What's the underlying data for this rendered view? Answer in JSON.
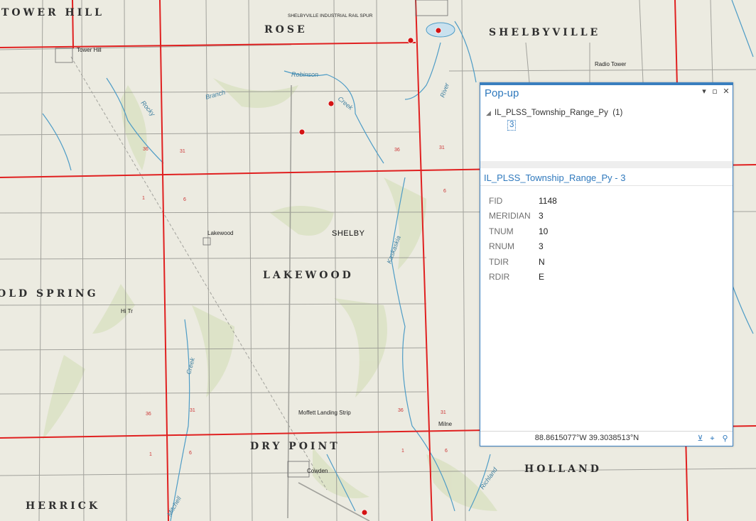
{
  "map": {
    "townships": [
      "TOWER HILL",
      "ROSE",
      "SHELBYVILLE",
      "LAKEWOOD",
      "OLD SPRING",
      "DRY POINT",
      "HOLLAND",
      "HERRICK"
    ],
    "places": [
      "Tower Hill",
      "Lakewood",
      "Cowden",
      "Radio Tower",
      "Moffett Landing Strip",
      "Milne",
      "SHELBYVILLE INDUSTRIAL RAIL SPUR",
      "Hi Tr"
    ],
    "waterways": [
      "Robinson",
      "Creek",
      "Rocky",
      "Branch",
      "Kaskaskia",
      "River",
      "Richland",
      "Mitchell",
      "Creek"
    ],
    "selected_label": "SHELBY",
    "section_numbers": [
      "36",
      "31",
      "1",
      "6",
      "36",
      "31",
      "36",
      "31",
      "1",
      "6",
      "6",
      "36",
      "31",
      "1",
      "6"
    ],
    "colors": {
      "grid_line": "#e02020",
      "marker": "#d41414",
      "water": "#4e9cc6",
      "terrain": "#ecebe1"
    }
  },
  "popup": {
    "title": "Pop-up",
    "layer_name": "IL_PLSS_Township_Range_Py",
    "layer_count": "(1)",
    "feature_id": "3",
    "record_title": "IL_PLSS_Township_Range_Py - 3",
    "attributes": [
      {
        "key": "FID",
        "value": "1148"
      },
      {
        "key": "MERIDIAN",
        "value": "3"
      },
      {
        "key": "TNUM",
        "value": "10"
      },
      {
        "key": "RNUM",
        "value": "3"
      },
      {
        "key": "TDIR",
        "value": "N"
      },
      {
        "key": "RDIR",
        "value": "E"
      }
    ],
    "coordinates": "88.8615077°W 39.3038513°N",
    "icons": [
      "menu-dropdown-icon",
      "maximize-icon",
      "close-icon",
      "filter-icon",
      "locate-icon",
      "zoom-icon"
    ]
  }
}
